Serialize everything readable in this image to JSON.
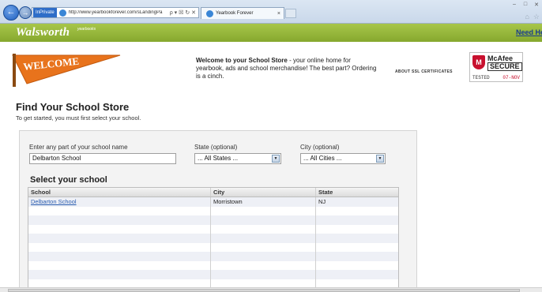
{
  "browser": {
    "inprivate_label": "InPrivate",
    "url": "http://www.yearbookforever.com/sLandingPa",
    "address_tools": "ρ ▾ ☒ ↻ ✕",
    "tab_title": "Yearbook Forever",
    "tab_close": "×"
  },
  "site": {
    "logo": "Walsworth",
    "logo_sub": "yearbooks",
    "help_link": "Need He"
  },
  "welcome": {
    "pennant_text": "WELCOME",
    "intro_bold": "Welcome to your School Store",
    "intro_rest": " - your online home for yearbook, ads and school merchandise! The best part? Ordering is a cinch.",
    "ssl_link": "ABOUT SSL CERTIFICATES"
  },
  "mcafee": {
    "name": "McAfee",
    "secure": "SECURE",
    "tested": "TESTED",
    "date": "07-NOV"
  },
  "find": {
    "title": "Find Your School Store",
    "subtitle": "To get started, you must first select your school."
  },
  "form": {
    "school_label": "Enter any part of your school name",
    "school_value": "Delbarton School",
    "state_label": "State (optional)",
    "state_value": "... All States ...",
    "city_label": "City (optional)",
    "city_value": "... All Cities ..."
  },
  "results": {
    "title": "Select your school",
    "columns": [
      "School",
      "City",
      "State"
    ],
    "rows": [
      {
        "school": "Delbarton School",
        "city": "Morristown",
        "state": "NJ"
      }
    ]
  },
  "colors": {
    "site_green": "#93b43a",
    "link_blue": "#2a5db0",
    "pennant_orange": "#e8731c",
    "mcafee_red": "#c8102e"
  }
}
